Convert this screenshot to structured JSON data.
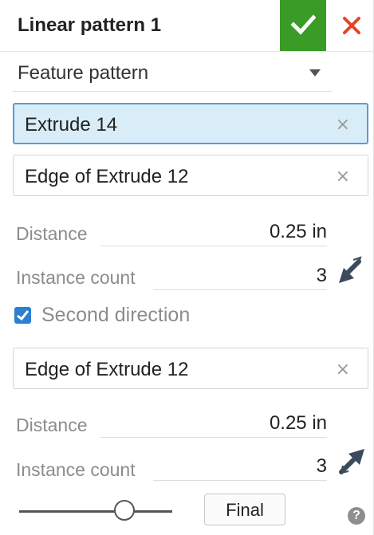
{
  "header": {
    "title": "Linear pattern 1",
    "ok_icon": "checkmark-icon",
    "cancel_icon": "close-x-icon",
    "colors": {
      "ok": "#3a9b27",
      "cancel": "#e0462b"
    }
  },
  "pattern_type": {
    "selected": "Feature pattern"
  },
  "first_direction": {
    "features_field": "Extrude 14",
    "direction_field": "Edge of Extrude 12",
    "distance_label": "Distance",
    "distance_value": "0.25 in",
    "count_label": "Instance count",
    "count_value": "3",
    "flip_icon": "opposite-direction-arrow-icon"
  },
  "second_direction": {
    "checkbox_label": "Second direction",
    "checked": true,
    "direction_field": "Edge of Extrude 12",
    "distance_label": "Distance",
    "distance_value": "0.25 in",
    "count_label": "Instance count",
    "count_value": "3",
    "flip_icon": "direction-arrow-icon"
  },
  "footer": {
    "final_label": "Final",
    "help_icon_text": "?"
  },
  "clear_glyph": "×"
}
